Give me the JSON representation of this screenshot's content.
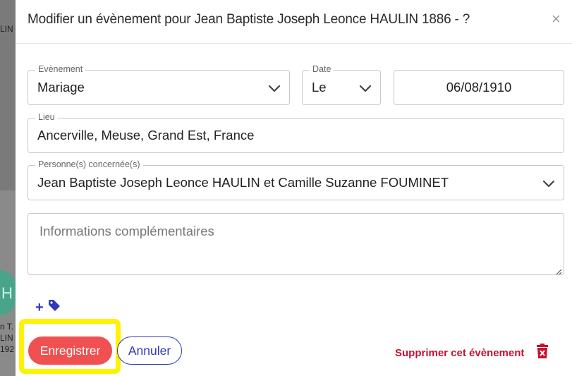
{
  "background": {
    "fragments": [
      "LIN",
      "n T.",
      "LIN",
      "192"
    ],
    "avatar_letter": "H"
  },
  "dialog": {
    "title": "Modifier un évènement pour Jean Baptiste Joseph Leonce HAULIN 1886 - ?",
    "close_symbol": "×"
  },
  "form": {
    "event": {
      "label": "Evènement",
      "value": "Mariage"
    },
    "date_mode": {
      "label": "Date",
      "value": "Le"
    },
    "date": {
      "value": "06/08/1910"
    },
    "place": {
      "label": "Lieu",
      "value": "Ancerville, Meuse, Grand Est, France"
    },
    "persons": {
      "label": "Personne(s) concernée(s)",
      "value": "Jean Baptiste Joseph Leonce HAULIN et Camille Suzanne FOUMINET"
    },
    "info": {
      "placeholder": "Informations complémentaires"
    }
  },
  "actions": {
    "save_label": "Enregistrer",
    "cancel_label": "Annuler",
    "delete_label": "Supprimer cet évènement"
  },
  "colors": {
    "primary": "#2e3ab8",
    "save_button": "#f0504f",
    "delete": "#c4122f",
    "highlight": "#fff200"
  },
  "icons": [
    "chevron-down-icon",
    "plus-icon",
    "tag-icon",
    "trash-icon",
    "close-icon"
  ]
}
